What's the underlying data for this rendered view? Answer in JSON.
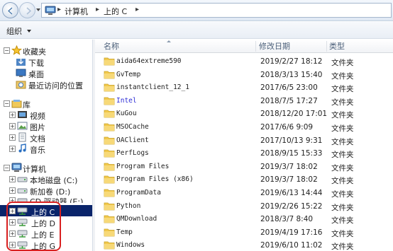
{
  "address": {
    "crumbs": [
      "计算机",
      "上的 C"
    ],
    "separator": "▸"
  },
  "toolbar": {
    "organize_label": "组织"
  },
  "nav": {
    "favorites_label": "收藏夹",
    "favorites_items": [
      "下载",
      "桌面",
      "最近访问的位置"
    ],
    "libraries_label": "库",
    "libraries_items": [
      "视频",
      "图片",
      "文档",
      "音乐"
    ],
    "computer_label": "计算机",
    "computer_items": [
      "本地磁盘 (C:)",
      "新加卷 (D:)",
      "CD 驱动器 (E:)"
    ],
    "network_drives": [
      "上的 C",
      "上的 D",
      "上的 E",
      "上的 G"
    ],
    "selected_drive": "上的 C",
    "highlight_color": "#d92020"
  },
  "columns": {
    "name": "名称",
    "date": "修改日期",
    "type": "类型"
  },
  "colors": {
    "selection": "#0a246a",
    "special_folder_text": "#2d2dd6",
    "folder": "#f2c94c"
  },
  "files": [
    {
      "name": "aida64extreme590",
      "date": "2019/2/27 18:12",
      "type": "文件夹"
    },
    {
      "name": "GvTemp",
      "date": "2018/3/13 15:40",
      "type": "文件夹"
    },
    {
      "name": "instantclient_12_1",
      "date": "2017/6/5 23:00",
      "type": "文件夹"
    },
    {
      "name": "Intel",
      "date": "2018/7/5 17:27",
      "type": "文件夹"
    },
    {
      "name": "KuGou",
      "date": "2018/12/20 17:01",
      "type": "文件夹"
    },
    {
      "name": "MSOCache",
      "date": "2017/6/6 9:09",
      "type": "文件夹"
    },
    {
      "name": "OAClient",
      "date": "2017/10/13 9:31",
      "type": "文件夹"
    },
    {
      "name": "PerfLogs",
      "date": "2018/9/15 15:33",
      "type": "文件夹"
    },
    {
      "name": "Program Files",
      "date": "2019/3/7 18:02",
      "type": "文件夹"
    },
    {
      "name": "Program Files (x86)",
      "date": "2019/3/7 18:02",
      "type": "文件夹"
    },
    {
      "name": "ProgramData",
      "date": "2019/6/13 14:44",
      "type": "文件夹"
    },
    {
      "name": "Python",
      "date": "2019/2/26 15:22",
      "type": "文件夹"
    },
    {
      "name": "QMDownload",
      "date": "2018/3/7 8:40",
      "type": "文件夹"
    },
    {
      "name": "Temp",
      "date": "2019/4/19 17:16",
      "type": "文件夹"
    },
    {
      "name": "Windows",
      "date": "2019/6/10 11:02",
      "type": "文件夹"
    }
  ]
}
